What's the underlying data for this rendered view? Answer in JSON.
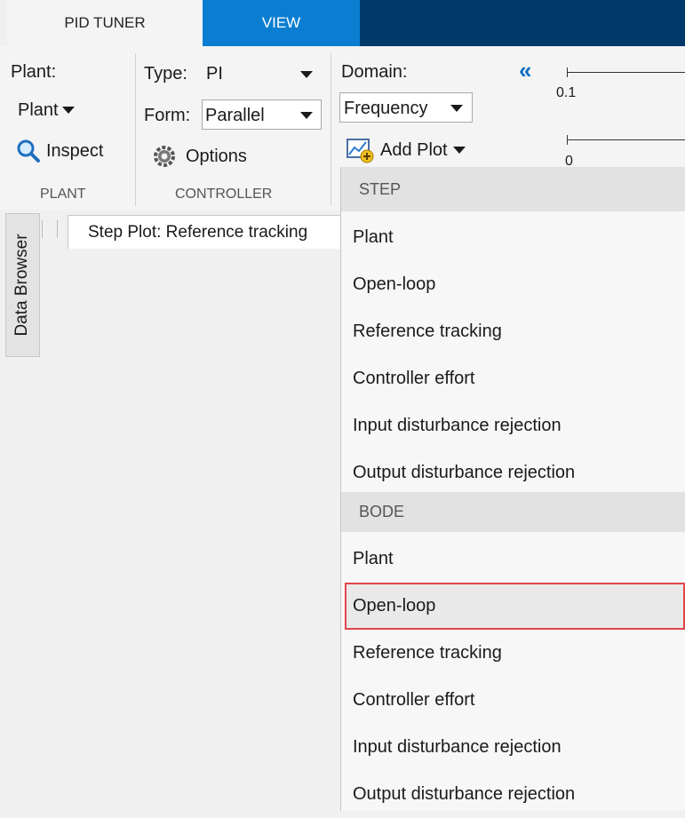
{
  "tabs": {
    "pid_tuner": "PID TUNER",
    "view": "VIEW"
  },
  "plant_section": {
    "plant_label": "Plant:",
    "plant_dropdown": "Plant",
    "inspect_button": "Inspect",
    "section_label": "PLANT"
  },
  "controller_section": {
    "type_label": "Type:",
    "type_value": "PI",
    "form_label": "Form:",
    "form_value": "Parallel",
    "options_button": "Options",
    "section_label": "CONTROLLER"
  },
  "domain_section": {
    "domain_label": "Domain:",
    "domain_value": "Frequency",
    "add_plot_button": "Add Plot"
  },
  "sliders": {
    "slider1_value": "0.1",
    "slider2_value": "0"
  },
  "side_panel": {
    "data_browser_label": "Data Browser"
  },
  "document_tab": {
    "label": "Step Plot: Reference tracking"
  },
  "add_plot_menu": {
    "step_header": "STEP",
    "step_items": [
      "Plant",
      "Open-loop",
      "Reference tracking",
      "Controller effort",
      "Input disturbance rejection",
      "Output disturbance rejection"
    ],
    "bode_header": "BODE",
    "bode_items": [
      "Plant",
      "Open-loop",
      "Reference tracking",
      "Controller effort",
      "Input disturbance rejection",
      "Output disturbance rejection"
    ],
    "highlighted_item": "Open-loop"
  },
  "colors": {
    "view_tab": "#0b7ed1",
    "tabbar_dark": "#01396a",
    "highlight_border": "#e0454a",
    "collapse_icon": "#0b6fc4"
  }
}
